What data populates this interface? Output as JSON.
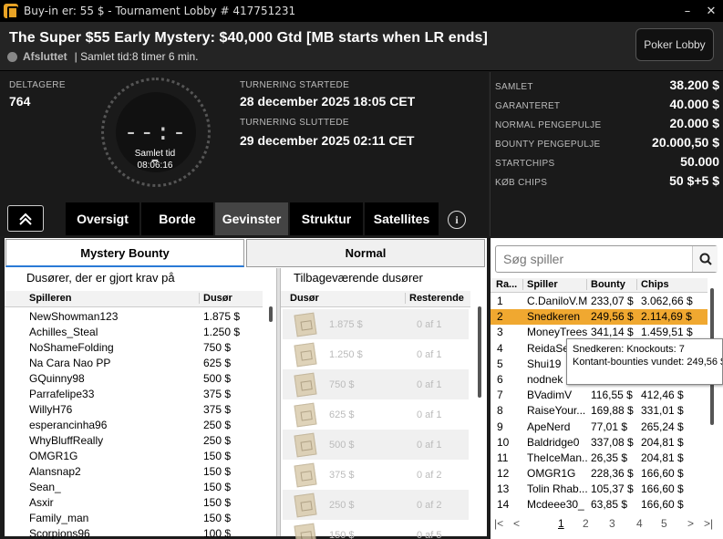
{
  "window": {
    "title": "Buy-in er: 55 $ - Tournament Lobby # 417751231",
    "minimize": "–",
    "close": "✕"
  },
  "header": {
    "title": "The Super $55 Early Mystery: $40,000 Gtd [MB starts when LR ends]",
    "status": "Afsluttet",
    "total_time": "| Samlet tid:8 timer   6 min.",
    "lobby_button": "Poker Lobby"
  },
  "info": {
    "players_label": "DELTAGERE",
    "players_value": "764",
    "clock_digits": "--:--",
    "clock_label": "Samlet tid",
    "clock_time": "08:06:16",
    "started_label": "TURNERING STARTEDE",
    "started_value": "28 december 2025  18:05 CET",
    "ended_label": "TURNERING SLUTTEDE",
    "ended_value": "29 december 2025  02:11 CET"
  },
  "prize": [
    {
      "label": "SAMLET",
      "value": "38.200 $"
    },
    {
      "label": "GARANTERET",
      "value": "40.000 $"
    },
    {
      "label": "NORMAL PENGEPULJE",
      "value": "20.000 $"
    },
    {
      "label": "BOUNTY PENGEPULJE",
      "value": "20.000,50 $"
    },
    {
      "label": "STARTCHIPS",
      "value": "50.000"
    },
    {
      "label": "KØB CHIPS",
      "value": "50 $+5 $"
    }
  ],
  "tabs": [
    "Oversigt",
    "Borde",
    "Gevinster",
    "Struktur",
    "Satellites"
  ],
  "info_icon": "i",
  "subtabs": [
    "Mystery Bounty",
    "Normal"
  ],
  "claimed": {
    "title": "Dusører, der er gjort krav på",
    "col_player": "Spilleren",
    "col_bounty": "Dusør",
    "rows": [
      {
        "player": "NewShowman123",
        "bounty": "1.875 $"
      },
      {
        "player": "Achilles_Steal",
        "bounty": "1.250 $"
      },
      {
        "player": "NoShameFolding",
        "bounty": "750 $"
      },
      {
        "player": "Na Cara Nao PP",
        "bounty": "625 $"
      },
      {
        "player": "GQuinny98",
        "bounty": "500 $"
      },
      {
        "player": "Parrafelipe33",
        "bounty": "375 $"
      },
      {
        "player": "WillyH76",
        "bounty": "375 $"
      },
      {
        "player": "esperancinha96",
        "bounty": "250 $"
      },
      {
        "player": "WhyBluffReally",
        "bounty": "250 $"
      },
      {
        "player": "OMGR1G",
        "bounty": "150 $"
      },
      {
        "player": "Alansnap2",
        "bounty": "150 $"
      },
      {
        "player": "Sean_",
        "bounty": "150 $"
      },
      {
        "player": "Asxir",
        "bounty": "150 $"
      },
      {
        "player": "Family_man",
        "bounty": "150 $"
      },
      {
        "player": "Scorpions96",
        "bounty": "100 $"
      }
    ]
  },
  "remaining": {
    "title": "Tilbageværende dusører",
    "col_bounty": "Dusør",
    "col_remaining": "Resterende",
    "rows": [
      {
        "bounty": "1.875 $",
        "left": "0 af 1"
      },
      {
        "bounty": "1.250 $",
        "left": "0 af 1"
      },
      {
        "bounty": "750 $",
        "left": "0 af 1"
      },
      {
        "bounty": "625 $",
        "left": "0 af 1"
      },
      {
        "bounty": "500 $",
        "left": "0 af 1"
      },
      {
        "bounty": "375 $",
        "left": "0 af 2"
      },
      {
        "bounty": "250 $",
        "left": "0 af 2"
      },
      {
        "bounty": "150 $",
        "left": "0 af 5"
      }
    ]
  },
  "players": {
    "search_placeholder": "Søg spiller",
    "col_rank": "Ra...",
    "col_player": "Spiller",
    "col_bounty": "Bounty",
    "col_chips": "Chips",
    "rows": [
      {
        "rank": "1",
        "name": "C.DaniloV.M",
        "bounty": "233,07 $",
        "chips": "3.062,66 $"
      },
      {
        "rank": "2",
        "name": "Snedkeren",
        "bounty": "249,56 $",
        "chips": "2.114,69 $"
      },
      {
        "rank": "3",
        "name": "MoneyTrees",
        "bounty": "341,14 $",
        "chips": "1.459,51 $"
      },
      {
        "rank": "4",
        "name": "ReidaSe",
        "bounty": "",
        "chips": ""
      },
      {
        "rank": "5",
        "name": "Shui19",
        "bounty": "",
        "chips": ""
      },
      {
        "rank": "6",
        "name": "nodnek",
        "bounty": "",
        "chips": ""
      },
      {
        "rank": "7",
        "name": "BVadimV",
        "bounty": "116,55 $",
        "chips": "412,46 $"
      },
      {
        "rank": "8",
        "name": "RaiseYour...",
        "bounty": "169,88 $",
        "chips": "331,01 $"
      },
      {
        "rank": "9",
        "name": "ApeNerd",
        "bounty": "77,01 $",
        "chips": "265,24 $"
      },
      {
        "rank": "10",
        "name": "Baldridge0",
        "bounty": "337,08 $",
        "chips": "204,81 $"
      },
      {
        "rank": "11",
        "name": "TheIceMan...",
        "bounty": "26,35 $",
        "chips": "204,81 $"
      },
      {
        "rank": "12",
        "name": "OMGR1G",
        "bounty": "228,36 $",
        "chips": "166,60 $"
      },
      {
        "rank": "13",
        "name": "Tolin Rhab...",
        "bounty": "105,37 $",
        "chips": "166,60 $"
      },
      {
        "rank": "14",
        "name": "Mcdeee30_",
        "bounty": "63,85 $",
        "chips": "166,60 $"
      }
    ],
    "pages": [
      "1",
      "2",
      "3",
      "4",
      "5"
    ],
    "nav_first": "|<",
    "nav_prev": "<",
    "nav_next": ">",
    "nav_last": ">|"
  },
  "tooltip": {
    "line1": "Snedkeren: Knockouts: 7",
    "line2": "Kontant-bounties vundet: 249,56 $"
  },
  "colors": {
    "highlight": "#f0a830",
    "active_tab": "#444444",
    "subtab_underline": "#2a7ad6"
  }
}
